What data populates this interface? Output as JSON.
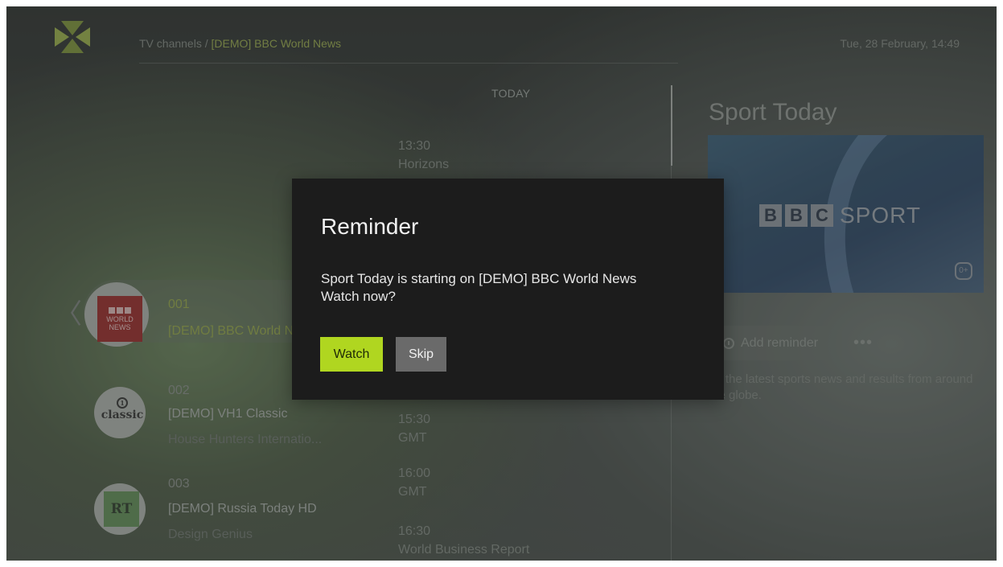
{
  "header": {
    "breadcrumb_root": "TV channels /",
    "breadcrumb_current": "[DEMO] BBC World News",
    "datetime": "Tue, 28 February, 14:49"
  },
  "schedule": {
    "day_label": "TODAY",
    "programs": [
      {
        "time": "13:30",
        "title": "Horizons"
      },
      {
        "time": "15:30",
        "title": "GMT"
      },
      {
        "time": "16:00",
        "title": "GMT"
      },
      {
        "time": "16:30",
        "title": "World Business Report"
      }
    ]
  },
  "channels": [
    {
      "number": "001",
      "name": "[DEMO] BBC World News",
      "now": "",
      "logo": "BBC WORLD NEWS",
      "selected": true
    },
    {
      "number": "002",
      "name": "[DEMO] VH1 Classic",
      "now": "House Hunters Internatio...",
      "logo": "classic"
    },
    {
      "number": "003",
      "name": "[DEMO] Russia Today HD",
      "now": "Design Genius",
      "logo": "RT"
    }
  ],
  "details": {
    "title": "Sport Today",
    "thumb_brand_letters": [
      "B",
      "B",
      "C"
    ],
    "thumb_brand_word": "SPORT",
    "age_badge": "0+",
    "reminder_label": "Add reminder",
    "more_label": "•••",
    "description": "All the latest sports news and results from around the globe."
  },
  "modal": {
    "title": "Reminder",
    "message_line1": "Sport Today is starting on [DEMO] BBC World News",
    "message_line2": "Watch now?",
    "watch_label": "Watch",
    "skip_label": "Skip"
  },
  "colors": {
    "accent": "#b0d620",
    "modal_bg": "#1c1c1c",
    "skip_bg": "#6a6a6a"
  },
  "icons": [
    "app-logo-icon",
    "chevron-left-icon",
    "alarm-clock-icon",
    "more-dots-icon",
    "age-rating-icon"
  ]
}
